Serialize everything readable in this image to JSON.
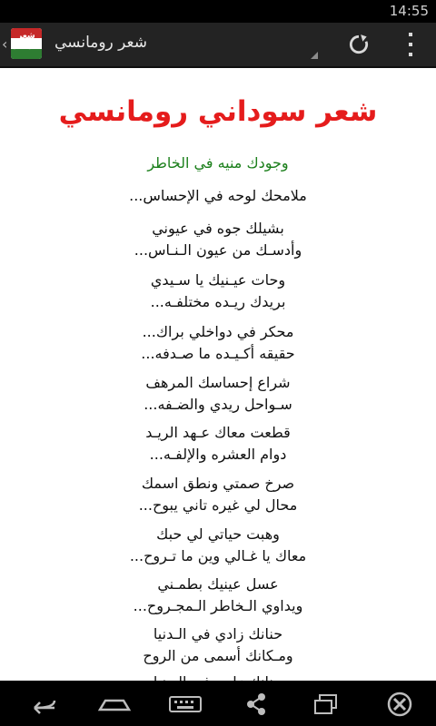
{
  "status_bar": {
    "time": "14:55"
  },
  "action_bar": {
    "title": "شعر رومانسي",
    "app_icon_text": "شعر سوداني"
  },
  "poem": {
    "title": "شعر سوداني رومانسي",
    "subtitle": "وجودك منيه في الخاطر",
    "stanzas": [
      [
        "ملامحك لوحه في الإحساس..."
      ],
      [
        "بشيلك جوه في عيوني",
        "وأدسـك من عيون الـنـاس..."
      ],
      [
        "وحات عيـنيك يا سـيدي",
        "بريدك ريـده مختلفـه..."
      ],
      [
        "محكر في دواخلي براك...",
        "حقيقه أكـيـده ما صـدفه..."
      ],
      [
        "شراع إحساسك المرهف",
        "سـواحل ريدي والضـفه..."
      ],
      [
        "قطعت معاك عـهد الريـد",
        "دوام العشره والإلفـه..."
      ],
      [
        "صرخ صمتي ونطق اسمك",
        "محال لي غيره تاني يبوح..."
      ],
      [
        "وهبت حياتي لي حبك",
        "معاك يا غـالي وين ما تـروح..."
      ],
      [
        "عسل عينيك بطمـني",
        "ويداوي الـخاطر الـمجـروح..."
      ],
      [
        "حنانك زادي في الـدنيا",
        "ومـكانك أسمى من الروح"
      ],
      [
        "حنانك زادي في الـدنيا"
      ]
    ]
  },
  "colors": {
    "title_red": "#e51c1c",
    "subtitle_green": "#1b7f1b",
    "action_bar_bg": "#232323"
  },
  "nav_bar": {
    "icons": [
      "back-icon",
      "home-icon",
      "keyboard-icon",
      "share-icon",
      "recent-apps-icon",
      "close-icon"
    ]
  }
}
